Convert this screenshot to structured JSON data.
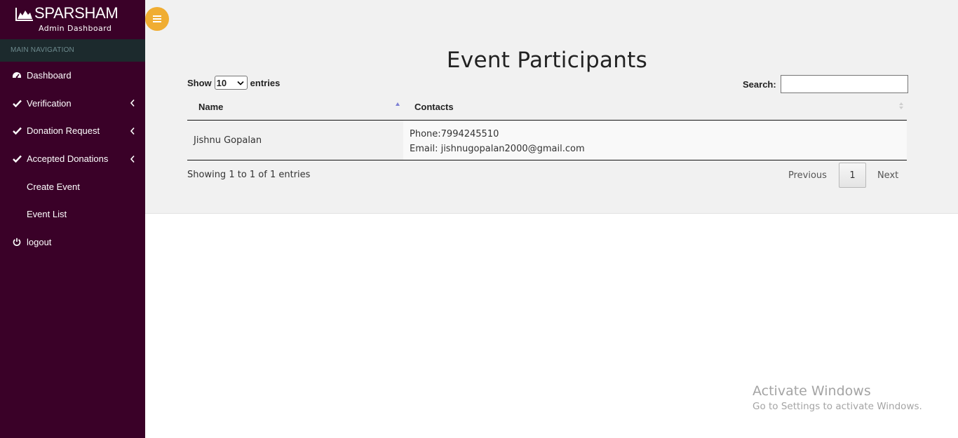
{
  "brand": {
    "name": "SPARSHAM",
    "subtitle": "Admin Dashboard",
    "logo_icon": "mountain-logo-icon"
  },
  "sidebar": {
    "header": "MAIN NAVIGATION",
    "items": [
      {
        "label": "Dashboard",
        "icon": "dashboard-icon",
        "has_chevron": false
      },
      {
        "label": "Verification",
        "icon": "check-icon",
        "has_chevron": true
      },
      {
        "label": "Donation Request",
        "icon": "check-icon",
        "has_chevron": true
      },
      {
        "label": "Accepted Donations",
        "icon": "check-icon",
        "has_chevron": true
      },
      {
        "label": "Create Event",
        "icon": "",
        "has_chevron": false
      },
      {
        "label": "Event List",
        "icon": "",
        "has_chevron": false
      },
      {
        "label": "logout",
        "icon": "power-icon",
        "has_chevron": false
      }
    ]
  },
  "main": {
    "title": "Event Participants",
    "show_label": "Show",
    "entries_label": "entries",
    "page_length": "10",
    "search_label": "Search:",
    "search_value": "",
    "table": {
      "columns": [
        "Name",
        "Contacts"
      ],
      "rows": [
        {
          "name": "Jishnu Gopalan",
          "phone": "Phone:7994245510",
          "email": "Email: jishnugopalan2000@gmail.com"
        }
      ]
    },
    "info": "Showing 1 to 1 of 1 entries",
    "pagination": {
      "previous": "Previous",
      "current": "1",
      "next": "Next"
    }
  },
  "watermark": {
    "line1": "Activate Windows",
    "line2": "Go to Settings to activate Windows."
  },
  "colors": {
    "sidebar": "#3a0128",
    "nav_header": "#1c2a2d",
    "toggle": "#f0ad32",
    "main_bg": "#f1f1f1"
  }
}
